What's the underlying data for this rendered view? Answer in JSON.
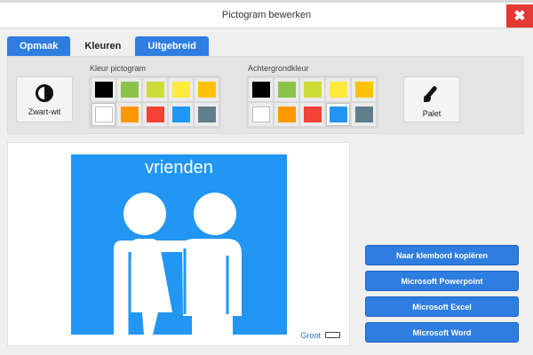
{
  "window": {
    "title": "Pictogram bewerken",
    "close_glyph": "✖"
  },
  "tabs": [
    {
      "label": "Opmaak",
      "active": false
    },
    {
      "label": "Kleuren",
      "active": true
    },
    {
      "label": "Uitgebreid",
      "active": false
    }
  ],
  "toolbar": {
    "bw_button": {
      "label": "Zwart-wit",
      "icon": "contrast-icon"
    },
    "palette_button": {
      "label": "Palet",
      "icon": "brush-icon"
    }
  },
  "pictogram_color": {
    "label": "Kleur pictogram",
    "colors": [
      "#000000",
      "#8bc34a",
      "#cddc39",
      "#ffeb3b",
      "#ffc107",
      "#ffffff",
      "#ff9800",
      "#f44336",
      "#2196f3",
      "#607d8b"
    ],
    "selected_index": 5
  },
  "background_color": {
    "label": "Achtergrondkleur",
    "colors": [
      "#000000",
      "#8bc34a",
      "#cddc39",
      "#ffeb3b",
      "#ffc107",
      "#ffffff",
      "#ff9800",
      "#f44336",
      "#2196f3",
      "#607d8b"
    ],
    "selected_index": 8
  },
  "preview": {
    "word": "vrienden",
    "background_color": "#2196f3",
    "figure_color": "#ffffff",
    "size_link": "Groot",
    "size_icon": "keyboard-icon"
  },
  "actions": [
    "Naar klembord kopiëren",
    "Microsoft Powerpoint",
    "Microsoft Excel",
    "Microsoft Word"
  ]
}
